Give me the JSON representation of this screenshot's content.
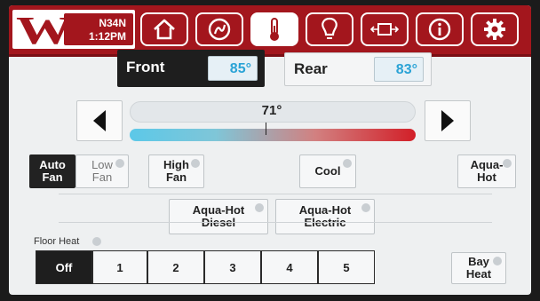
{
  "header": {
    "coach_id": "N34N",
    "time": "1:12PM",
    "nav": [
      {
        "icon": "home-icon"
      },
      {
        "icon": "generator-icon"
      },
      {
        "icon": "thermometer-icon",
        "active": true
      },
      {
        "icon": "lightbulb-icon"
      },
      {
        "icon": "slideout-icon"
      },
      {
        "icon": "info-icon"
      },
      {
        "icon": "gear-icon"
      }
    ],
    "colors": {
      "brand": "#a3161d",
      "cold": "#5cc8e8",
      "hot": "#d21f28"
    }
  },
  "zones": {
    "front": {
      "label": "Front",
      "temp": "85°"
    },
    "rear": {
      "label": "Rear",
      "temp": "83°"
    }
  },
  "setpoint": {
    "value": "71°"
  },
  "fan": {
    "auto": [
      "Auto",
      "Fan"
    ],
    "low": [
      "Low",
      "Fan"
    ],
    "high": [
      "High",
      "Fan"
    ],
    "selected": "auto"
  },
  "modes": {
    "cool": "Cool",
    "aqua_hot": [
      "Aqua-",
      "Hot"
    ],
    "aqua_hot_diesel": [
      "Aqua-Hot",
      "Diesel"
    ],
    "aqua_hot_electric": [
      "Aqua-Hot",
      "Electric"
    ]
  },
  "floor_heat": {
    "label": "Floor Heat",
    "options": [
      "Off",
      "1",
      "2",
      "3",
      "4",
      "5"
    ],
    "selected": "Off"
  },
  "bay_heat": [
    "Bay",
    "Heat"
  ]
}
